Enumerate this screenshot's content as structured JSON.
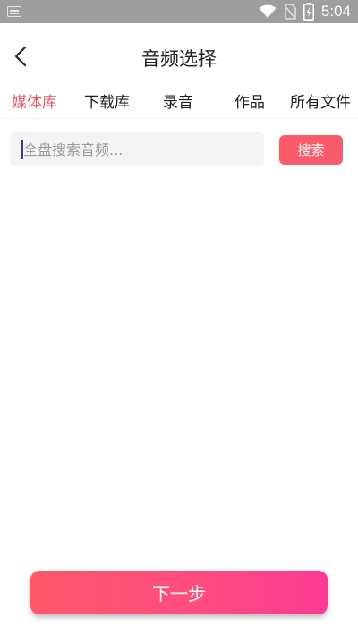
{
  "status_bar": {
    "time": "5:04",
    "icons": [
      "keyboard-icon",
      "wifi-icon",
      "no-sim-icon",
      "battery-icon"
    ]
  },
  "header": {
    "title": "音频选择",
    "back_icon": "chevron-left-icon"
  },
  "tabs": [
    {
      "label": "媒体库",
      "active": true
    },
    {
      "label": "下载库",
      "active": false
    },
    {
      "label": "录音",
      "active": false
    },
    {
      "label": "作品",
      "active": false
    },
    {
      "label": "所有文件",
      "active": false
    }
  ],
  "search": {
    "placeholder": "全盘搜索音频...",
    "value": "",
    "button_label": "搜索"
  },
  "footer": {
    "next_label": "下一步"
  },
  "colors": {
    "accent": "#e85664",
    "search_button": "#fb5a6a",
    "next_gradient_start": "#ff586a",
    "next_gradient_end": "#fd3a93",
    "status_bar": "#9e9e9e"
  }
}
